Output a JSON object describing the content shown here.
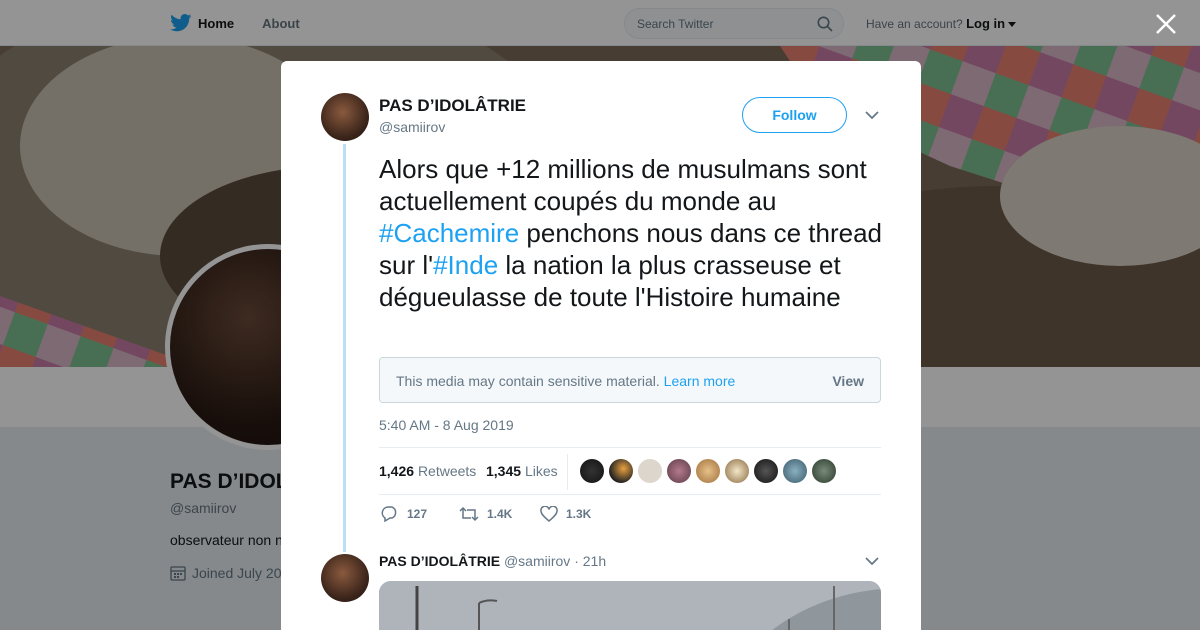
{
  "topbar": {
    "home_label": "Home",
    "about_label": "About",
    "search_placeholder": "Search Twitter",
    "account_prompt": "Have an account?",
    "login_label": "Log in"
  },
  "profile": {
    "name": "PAS D’IDOL",
    "handle": "@samiirov",
    "bio": "observateur non n",
    "joined": "Joined July 20"
  },
  "tweet": {
    "author_name": "PAS D’IDOLÂTRIE",
    "author_handle": "@samiirov",
    "follow_label": "Follow",
    "text_part1": "Alors que +12 millions de musulmans sont actuellement coupés du monde au ",
    "hashtag1": "#Cachemire",
    "text_part2": " penchons nous dans ce thread sur l'",
    "hashtag2": "#Inde",
    "text_part3": " la nation la plus crasseuse et dégueulasse de toute l'Histoire humaine",
    "sensitive_notice": "This media may contain sensitive material.",
    "learn_more_label": "Learn more",
    "view_label": "View",
    "timestamp": "5:40 AM - 8 Aug 2019",
    "retweets_count": "1,426",
    "retweets_label": "Retweets",
    "likes_count": "1,345",
    "likes_label": "Likes",
    "reply_count": "127",
    "retweet_action_count": "1.4K",
    "like_action_count": "1.3K"
  },
  "reply": {
    "author_name": "PAS D’IDOLÂTRIE",
    "author_handle": "@samiirov",
    "separator": "·",
    "time": "21h"
  },
  "colors": {
    "brand_blue": "#1da1f2",
    "thread_line": "#b9def7",
    "text_dark": "#14171a",
    "text_muted": "#657786"
  },
  "icons": [
    "twitter-bird-icon",
    "search-icon",
    "close-icon",
    "chevron-down-icon",
    "calendar-icon",
    "reply-icon",
    "retweet-icon",
    "heart-icon"
  ]
}
